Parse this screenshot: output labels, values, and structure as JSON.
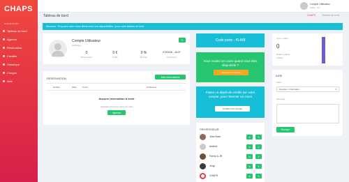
{
  "app": {
    "logo": "CHAPS"
  },
  "sidebar": {
    "heading": "NAVIGATION",
    "items": [
      {
        "label": "Tableau de bord"
      },
      {
        "label": "Agenda"
      },
      {
        "label": "Réservation"
      },
      {
        "label": "Créditer"
      },
      {
        "label": "Historique"
      },
      {
        "label": "Compte"
      },
      {
        "label": "Aide"
      }
    ]
  },
  "topbar": {
    "user_name": "Compte Utilisateur",
    "user_sub": "Solde : 0 €"
  },
  "header": {
    "title": "Tableau de bord",
    "crumb_home": "CHAPS",
    "crumb_current": "Tableau de bord"
  },
  "notice": {
    "text": "Nouveau : Proposez votre cours libres selon vos disponibilités ! pour votre tableau de bord."
  },
  "profile": {
    "name": "Compte Utilisateur",
    "role": "Utilisateur",
    "stats": [
      {
        "value": "0",
        "label": "Réservation"
      },
      {
        "value": "0 €",
        "label": "Solde"
      },
      {
        "value": "0 %",
        "label": "Remise"
      },
      {
        "value": "07/03/26 - 16:37",
        "label": "Connexion"
      }
    ],
    "edit_btn": "✎"
  },
  "reservations": {
    "title": "RESERVATION",
    "button": "Mes réservations",
    "columns": [
      "Horaire",
      "Salle",
      "Cours",
      "Professeur"
    ],
    "empty_title": "Aucune réservation à venir",
    "empty_sub": "Inscrivez-vous à un cours sur notre",
    "agenda_btn": "Agenda"
  },
  "code_card": {
    "text": "Code porte : 41468"
  },
  "promo_card": {
    "text": "Vous voulez un cours quand vous êtes disponible ?",
    "button": "Proposer un créneau"
  },
  "deposit_card": {
    "text": "Faites un dépôt de crédits sur votre compte, pour réserver un cours",
    "button": "Créditer mon compte"
  },
  "professors": {
    "title": "PROFESSEUR",
    "list": [
      {
        "name": "Jean Noel",
        "color": "#8b6b5a"
      },
      {
        "name": "Andrea",
        "color": "#c9c9c9"
      },
      {
        "name": "Fanny & JR",
        "color": "#6b4e3d"
      },
      {
        "name": "Jergi",
        "color": "#3b3b3b"
      },
      {
        "name": "CHAPS",
        "color": "#e83a45"
      }
    ]
  },
  "hours": {
    "label": "Cours / Mois",
    "value": "0",
    "sub": "Reste à placer",
    "sub_value": "0 (0 €)"
  },
  "help": {
    "title": "AIDE",
    "subject_label": "Sujet",
    "subject_value": "Question / Information",
    "message_label": "Message",
    "send_btn": "Envoyer"
  },
  "colors": {
    "accent": "#f0483e",
    "teal": "#16bfd6",
    "green": "#27c56f",
    "orange": "#f5a623"
  }
}
